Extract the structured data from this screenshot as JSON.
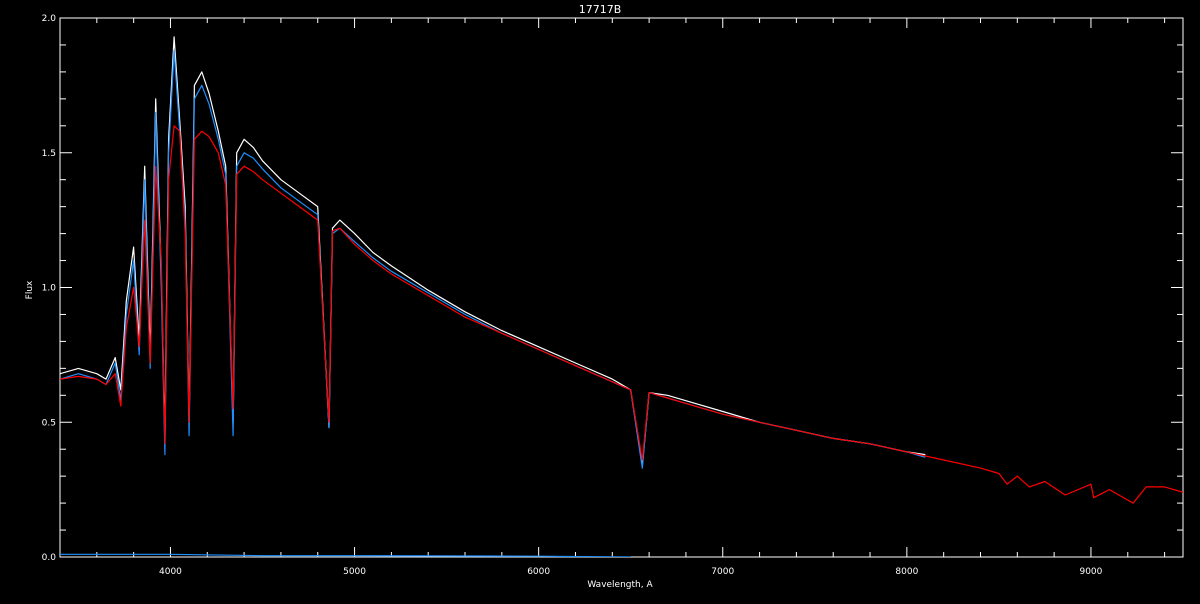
{
  "chart_data": {
    "type": "line",
    "title": "17717B",
    "xlabel": "Wavelength, A",
    "ylabel": "Flux",
    "xlim": [
      3400,
      9500
    ],
    "ylim": [
      0.0,
      2.0
    ],
    "x_ticks": [
      4000,
      5000,
      6000,
      7000,
      8000,
      9000
    ],
    "x_tick_labels": [
      "4000",
      "5000",
      "6000",
      "7000",
      "8000",
      "9000"
    ],
    "y_ticks": [
      0.0,
      0.5,
      1.0,
      1.5,
      2.0
    ],
    "y_tick_labels": [
      "0.0",
      "0.5",
      "1.0",
      "1.5",
      "2.0"
    ],
    "grid": false,
    "background": "#000000",
    "axis_color": "#ffffff",
    "series": [
      {
        "color": "#ffffff",
        "x": [
          3400,
          3500,
          3600,
          3650,
          3700,
          3730,
          3760,
          3800,
          3830,
          3860,
          3890,
          3920,
          3950,
          3970,
          3990,
          4020,
          4050,
          4080,
          4101,
          4130,
          4170,
          4210,
          4260,
          4300,
          4340,
          4360,
          4400,
          4450,
          4500,
          4600,
          4700,
          4800,
          4861,
          4880,
          4920,
          5000,
          5100,
          5200,
          5400,
          5600,
          5800,
          6000,
          6200,
          6400,
          6500,
          6563,
          6600,
          6700,
          6800,
          7000,
          7200,
          7400,
          7600,
          7800,
          8000,
          8100
        ],
        "y": [
          0.68,
          0.7,
          0.68,
          0.66,
          0.74,
          0.62,
          0.95,
          1.15,
          0.8,
          1.45,
          0.75,
          1.7,
          1.05,
          0.45,
          1.55,
          1.93,
          1.62,
          1.3,
          0.5,
          1.75,
          1.8,
          1.72,
          1.58,
          1.45,
          0.5,
          1.5,
          1.55,
          1.52,
          1.47,
          1.4,
          1.35,
          1.3,
          0.48,
          1.22,
          1.25,
          1.2,
          1.13,
          1.08,
          0.99,
          0.91,
          0.84,
          0.78,
          0.72,
          0.66,
          0.62,
          0.34,
          0.61,
          0.6,
          0.58,
          0.54,
          0.5,
          0.47,
          0.44,
          0.42,
          0.39,
          0.38
        ]
      },
      {
        "color": "#1e90ff",
        "x": [
          3400,
          3500,
          3600,
          3650,
          3700,
          3730,
          3760,
          3800,
          3830,
          3860,
          3890,
          3920,
          3950,
          3970,
          3990,
          4020,
          4050,
          4080,
          4101,
          4130,
          4170,
          4210,
          4260,
          4300,
          4340,
          4360,
          4400,
          4450,
          4500,
          4600,
          4700,
          4800,
          4861,
          4880,
          4920,
          5000,
          5100,
          5200,
          5400,
          5600,
          5800,
          6000,
          6200,
          6400,
          6500,
          6563,
          6600,
          6700,
          6800,
          7000,
          7200,
          7400,
          7600,
          7800,
          8000,
          8100
        ],
        "y": [
          0.66,
          0.68,
          0.66,
          0.64,
          0.72,
          0.58,
          0.9,
          1.1,
          0.75,
          1.4,
          0.7,
          1.65,
          1.0,
          0.38,
          1.5,
          1.88,
          1.58,
          1.25,
          0.45,
          1.7,
          1.75,
          1.68,
          1.55,
          1.42,
          0.45,
          1.45,
          1.5,
          1.48,
          1.44,
          1.37,
          1.32,
          1.27,
          0.48,
          1.2,
          1.22,
          1.17,
          1.11,
          1.06,
          0.98,
          0.9,
          0.83,
          0.77,
          0.71,
          0.65,
          0.62,
          0.33,
          0.61,
          0.59,
          0.57,
          0.53,
          0.5,
          0.47,
          0.44,
          0.42,
          0.39,
          0.37
        ]
      },
      {
        "color": "#ff0000",
        "x": [
          3400,
          3500,
          3600,
          3650,
          3700,
          3730,
          3760,
          3800,
          3830,
          3860,
          3890,
          3920,
          3950,
          3970,
          3990,
          4020,
          4050,
          4080,
          4101,
          4130,
          4170,
          4210,
          4260,
          4300,
          4340,
          4360,
          4400,
          4450,
          4500,
          4600,
          4700,
          4800,
          4861,
          4880,
          4920,
          5000,
          5100,
          5200,
          5400,
          5600,
          5800,
          6000,
          6200,
          6400,
          6500,
          6563,
          6600,
          6700,
          6800,
          7000,
          7200,
          7400,
          7600,
          7800,
          8000,
          8200,
          8400,
          8500,
          8545,
          8600,
          8665,
          8750,
          8860,
          9000,
          9015,
          9100,
          9229,
          9300,
          9400,
          9500
        ],
        "y": [
          0.66,
          0.67,
          0.66,
          0.64,
          0.68,
          0.56,
          0.85,
          1.0,
          0.78,
          1.25,
          0.72,
          1.45,
          1.1,
          0.42,
          1.4,
          1.6,
          1.58,
          1.2,
          0.5,
          1.55,
          1.58,
          1.56,
          1.5,
          1.38,
          0.55,
          1.42,
          1.45,
          1.43,
          1.4,
          1.35,
          1.3,
          1.25,
          0.5,
          1.21,
          1.22,
          1.16,
          1.1,
          1.05,
          0.97,
          0.89,
          0.83,
          0.77,
          0.71,
          0.65,
          0.62,
          0.36,
          0.61,
          0.59,
          0.57,
          0.53,
          0.5,
          0.47,
          0.44,
          0.42,
          0.39,
          0.36,
          0.33,
          0.31,
          0.27,
          0.3,
          0.26,
          0.28,
          0.23,
          0.27,
          0.22,
          0.25,
          0.2,
          0.26,
          0.26,
          0.24
        ]
      },
      {
        "color": "#1e90ff",
        "x": [
          3400,
          4000,
          4500,
          5000,
          6000,
          6500
        ],
        "y": [
          0.01,
          0.01,
          0.005,
          0.005,
          0.003,
          0.0
        ]
      }
    ]
  }
}
